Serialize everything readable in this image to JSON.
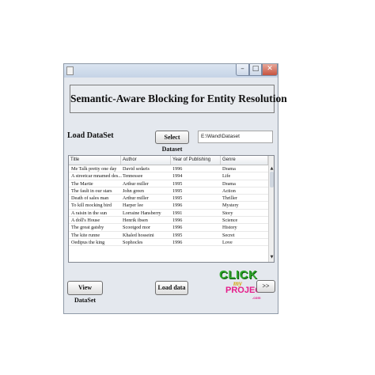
{
  "window": {
    "title_buttons": {
      "minimize": "–",
      "maximize": "□",
      "close": "✕"
    }
  },
  "banner": {
    "title": "Semantic-Aware Blocking for Entity Resolution"
  },
  "dataset": {
    "label": "Load DataSet",
    "select_button": "Select Dataset",
    "path_value": "E:\\Wand\\Dataset"
  },
  "table": {
    "columns": [
      "Title",
      "Author",
      "Year of Publishing",
      "Genre"
    ],
    "rows": [
      [
        "Me Talk pretty one day",
        "David sedaris",
        "1996",
        "Drama"
      ],
      [
        "A streetcar mnamed des...",
        "Tennessee",
        "1994",
        "Life"
      ],
      [
        "The Martie",
        "Arthur miller",
        "1995",
        "Drama"
      ],
      [
        "The fault in our stars",
        "John green",
        "1995",
        "Action"
      ],
      [
        "Death of sales man",
        "Arthur miller",
        "1995",
        "Thriller"
      ],
      [
        "To kill mocking bird",
        "Harper lee",
        "1996",
        "Mystery"
      ],
      [
        "A raisin in the sun",
        "Lorraine Hansberry",
        "1991",
        "Story"
      ],
      [
        "A doll's House",
        "Henrik ibsen",
        "1996",
        "Science"
      ],
      [
        "The great gatsby",
        "Scootgod mor",
        "1996",
        "History"
      ],
      [
        "The kite runne",
        "Khaled hosseini",
        "1995",
        "Secret"
      ],
      [
        "Oedipus the king",
        "Sophocles",
        "1996",
        "Love"
      ]
    ],
    "scroll": {
      "up": "▲",
      "down": "▼"
    }
  },
  "footer": {
    "view_button": "View DataSet",
    "load_button": "Load data",
    "next_button": ">>"
  },
  "logo": {
    "line1": "CLICK",
    "line2": "my",
    "line3": "PROJECT",
    "line4": ".com"
  }
}
